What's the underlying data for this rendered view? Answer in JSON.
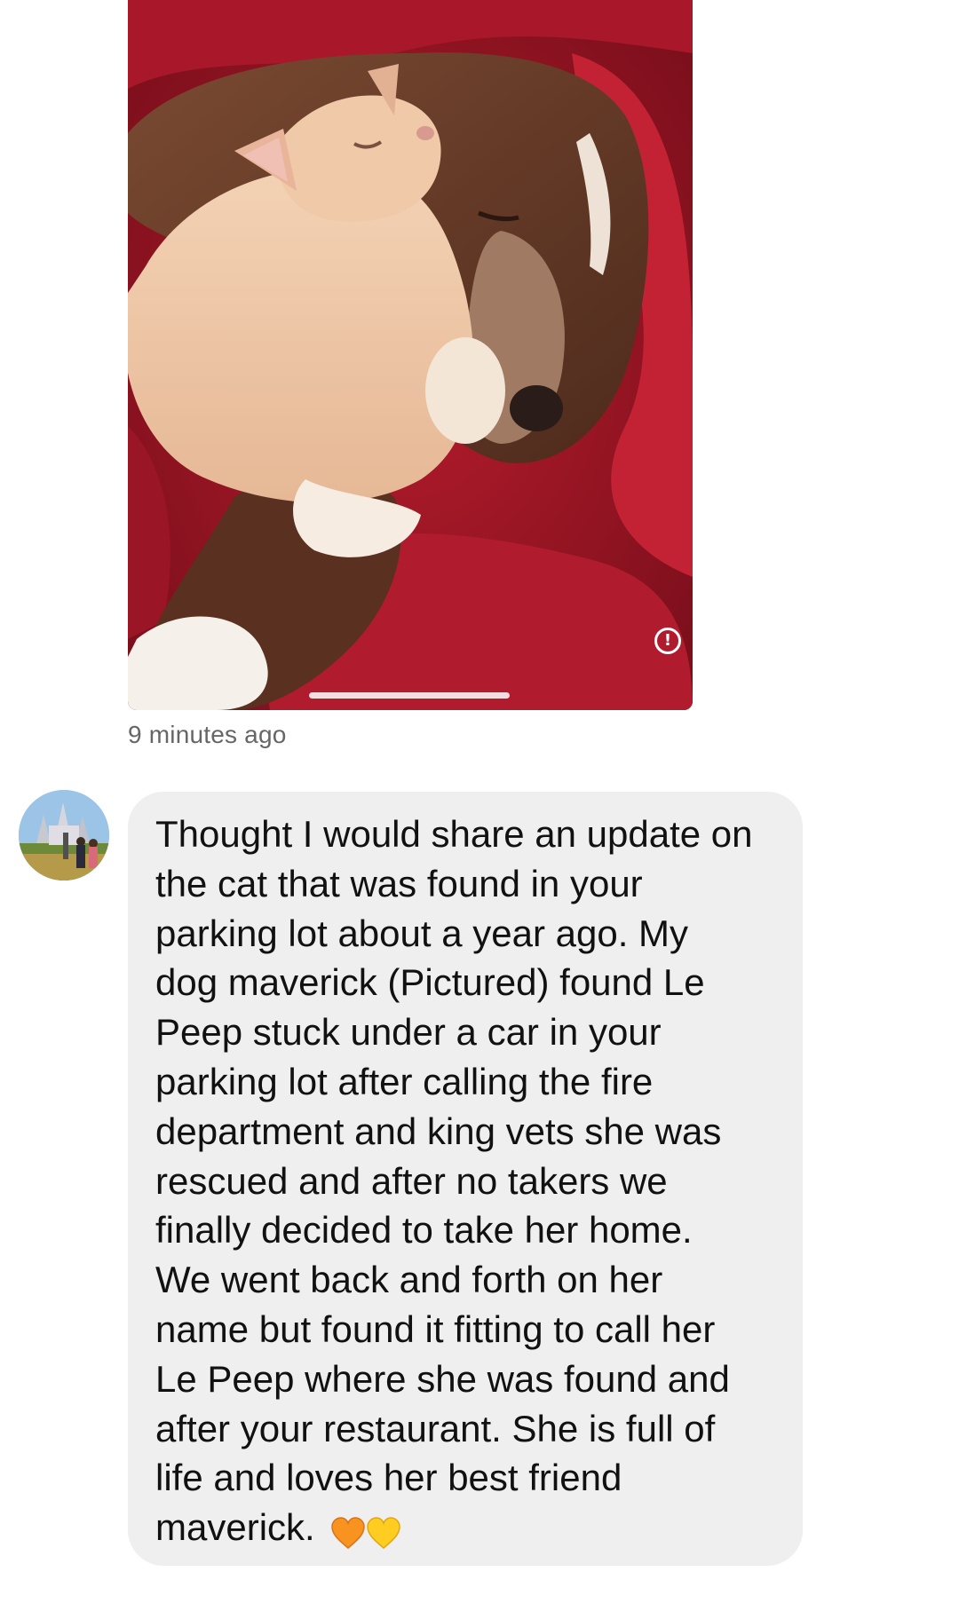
{
  "thread": {
    "image_message": {
      "description_icon": "photo-of-cat-and-dog",
      "info_icon": "info-circle-icon",
      "timestamp": "9 minutes ago"
    },
    "text_message": {
      "sender_avatar_icon": "avatar-photo",
      "text": "Thought I would share an update on\nthe cat that was found in your\nparking lot about a year ago. My\ndog maverick (Pictured) found Le\nPeep stuck under a car in your\nparking lot after calling the fire\ndepartment and king vets she was\nrescued and after no takers we\nfinally decided to take her home.\nWe went back and forth on her\nname but found it fitting to call her\nLe Peep where she was found and\nafter your restaurant. She is full of\nlife and loves her best friend\nmaverick.",
      "emoji": [
        {
          "icon": "orange-heart-icon",
          "color": "#f7931e"
        },
        {
          "icon": "yellow-heart-icon",
          "color": "#ffcc22"
        }
      ]
    }
  },
  "colors": {
    "bubble_bg": "#efefef",
    "text": "#111111",
    "timestamp": "#666666",
    "blanket_red": "#a01828"
  }
}
